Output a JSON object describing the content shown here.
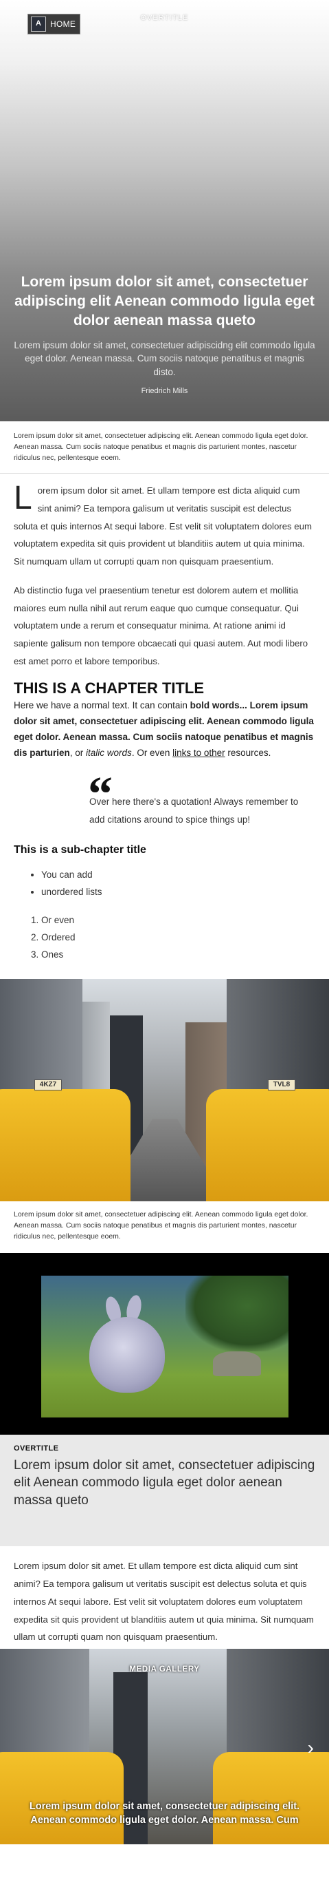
{
  "header": {
    "logo_text": "A",
    "home_label": "HOME",
    "overtitle": "OVERTITLE"
  },
  "hero": {
    "title": "Lorem ipsum dolor sit amet, consectetuer adipiscing elit Aenean commodo ligula eget dolor aenean massa queto",
    "subtitle": "Lorem ipsum dolor sit amet, consectetuer adipiscidng elit commodo ligula eget dolor. Aenean massa. Cum sociis natoque penatibus et magnis disto.",
    "author": "Friedrich Mills"
  },
  "caption_1": "Lorem ipsum dolor sit amet, consectetuer adipiscing elit. Aenean commodo ligula eget dolor. Aenean massa. Cum sociis natoque penatibus et magnis dis parturient montes, nascetur ridiculus nec, pellentesque eoem.",
  "article": {
    "dropcap": "L",
    "paragraph_1": "orem ipsum dolor sit amet. Et ullam tempore est dicta aliquid cum sint animi? Ea tempora galisum ut veritatis suscipit est delectus soluta et quis internos At sequi labore. Est velit sit voluptatem dolores eum voluptatem expedita sit quis provident ut blanditiis autem ut quia minima. Sit numquam ullam ut corrupti quam non quisquam praesentium.",
    "paragraph_2": "Ab distinctio fuga vel praesentium tenetur est dolorem autem et mollitia maiores eum nulla nihil aut rerum eaque quo cumque consequatur. Qui voluptatem unde a rerum et consequatur minima. At ratione animi id sapiente galisum non tempore obcaecati qui quasi autem. Aut modi libero est amet porro et labore temporibus.",
    "chapter_title": "THIS IS A CHAPTER TITLE",
    "normal_1": "Here we have a normal text. It can contain ",
    "bold_text": "bold words... Lorem ipsum dolor sit amet, consectetuer adipiscing elit. Aenean commodo ligula eget dolor. Aenean massa. Cum sociis natoque penatibus et magnis dis parturien",
    "normal_2": ", or ",
    "italic_text": "italic words",
    "normal_3": ". Or even ",
    "link_text": "links to other",
    "normal_4": " resources.",
    "quote": "Over here there's a quotation! Always remember to add citations around to spice things up!",
    "subchapter_title": "This is a sub-chapter title",
    "unordered": [
      "You can add",
      "unordered lists"
    ],
    "ordered": [
      "Or even",
      "Ordered",
      "Ones"
    ]
  },
  "city_image": {
    "cab_sign_left": "4KZ7",
    "cab_sign_right": "TVL8"
  },
  "caption_2": "Lorem ipsum dolor sit amet, consectetuer adipiscing elit. Aenean commodo ligula eget dolor. Aenean massa. Cum sociis natoque penatibus et magnis dis parturient montes, nascetur ridiculus nec, pellentesque eoem.",
  "overtitle_section": {
    "label": "OVERTITLE",
    "title": "Lorem ipsum dolor sit amet, consectetuer adipiscing elit Aenean commodo ligula eget dolor aenean massa queto"
  },
  "paragraph_3": "Lorem ipsum dolor sit amet. Et ullam tempore est dicta aliquid cum sint animi? Ea tempora galisum ut veritatis suscipit est delectus soluta et quis internos At sequi labore. Est velit sit voluptatem dolores eum voluptatem expedita sit quis provident ut blanditiis autem ut quia minima. Sit numquam ullam ut corrupti quam non quisquam praesentium.",
  "gallery": {
    "label": "MEDIA GALLERY",
    "next_arrow": "›",
    "title": "Lorem ipsum dolor sit amet, consectetuer adipiscing elit. Aenean commodo ligula eget dolor. Aenean massa. Cum"
  }
}
